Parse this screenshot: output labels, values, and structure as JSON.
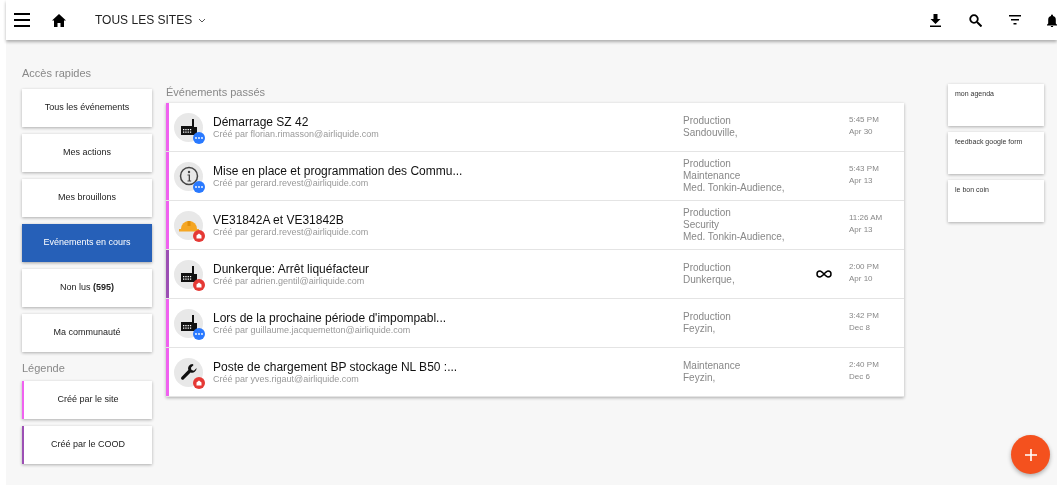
{
  "top_bar": {
    "site_selector": "TOUS LES SITES"
  },
  "quick_access": {
    "title": "Accès rapides",
    "items": [
      {
        "label": "Tous les événements",
        "selected": false
      },
      {
        "label": "Mes actions",
        "selected": false
      },
      {
        "label": "Mes brouillons",
        "selected": false
      },
      {
        "label": "Evénements en cours",
        "selected": true
      },
      {
        "label": "Non lus **(595)**",
        "selected": false
      },
      {
        "label": "Ma communauté",
        "selected": false
      }
    ]
  },
  "legend": {
    "title": "Légende",
    "items": [
      {
        "label": "Créé par le site",
        "color": "#f062f0"
      },
      {
        "label": "Créé par le COOD",
        "color": "#9c4fb4"
      }
    ]
  },
  "events": {
    "title": "Événements passés",
    "rows": [
      {
        "color": "#f062f0",
        "avatar": {
          "kind": "factory",
          "badge": {
            "kind": "pending"
          }
        },
        "title": "Démarrage SZ 42",
        "author": "Créé par florian.rimasson@airliquide.com",
        "tags": [
          "Production",
          "Sandouville,"
        ],
        "recurring": false,
        "time": "5:45 PM",
        "date": "Apr 30"
      },
      {
        "color": "#f062f0",
        "avatar": {
          "kind": "info",
          "badge": {
            "kind": "pending"
          }
        },
        "title": "Mise en place et programmation des Commu...",
        "author": "Créé par gerard.revest@airliquide.com",
        "tags": [
          "Production",
          "Maintenance",
          "Med. Tonkin-Audience,"
        ],
        "recurring": false,
        "time": "5:43 PM",
        "date": "Apr 13"
      },
      {
        "color": "#f062f0",
        "avatar": {
          "kind": "helmet",
          "badge": {
            "kind": "alert"
          }
        },
        "title": "VE31842A et VE31842B",
        "author": "Créé par gerard.revest@airliquide.com",
        "tags": [
          "Production",
          "Security",
          "Med. Tonkin-Audience,"
        ],
        "recurring": false,
        "time": "11:26 AM",
        "date": "Apr 13"
      },
      {
        "color": "#9c4fb4",
        "avatar": {
          "kind": "factory",
          "badge": {
            "kind": "alert"
          }
        },
        "title": "Dunkerque: Arrêt liquéfacteur",
        "author": "Créé par adrien.gentil@airliquide.com",
        "tags": [
          "Production",
          "Dunkerque,"
        ],
        "recurring": true,
        "time": "2:00 PM",
        "date": "Apr 10"
      },
      {
        "color": "#f062f0",
        "avatar": {
          "kind": "factory",
          "badge": {
            "kind": "pending"
          }
        },
        "title": "Lors de la prochaine période d'impompabl...",
        "author": "Créé par guillaume.jacquemetton@airliquide.com",
        "tags": [
          "Production",
          "Feyzin,"
        ],
        "recurring": false,
        "time": "3:42 PM",
        "date": "Dec 8"
      },
      {
        "color": "#f062f0",
        "avatar": {
          "kind": "wrench",
          "badge": {
            "kind": "alert"
          }
        },
        "title": "Poste de chargement BP stockage NL B50 :...",
        "author": "Créé par yves.rigaut@airliquide.com",
        "tags": [
          "Maintenance",
          "Feyzin,"
        ],
        "recurring": false,
        "time": "2:40 PM",
        "date": "Dec 6"
      }
    ]
  },
  "links": [
    "mon agenda",
    "feedback google form",
    "le bon coin"
  ]
}
